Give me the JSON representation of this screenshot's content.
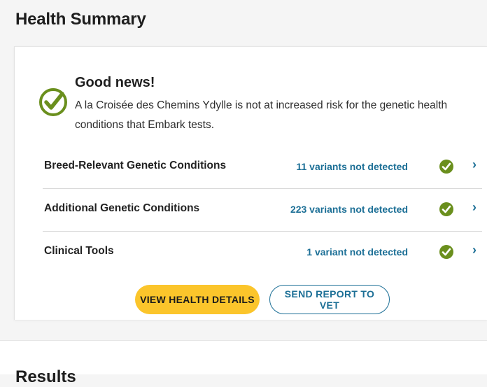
{
  "page": {
    "title": "Health Summary"
  },
  "summary": {
    "headline": "Good news!",
    "message": "A la Croisée des Chemins Ydylle is not at increased risk for the genetic health conditions that Embark tests.",
    "icon": "check-circle-icon"
  },
  "rows": [
    {
      "title": "Breed-Relevant Genetic Conditions",
      "status": "11 variants not detected"
    },
    {
      "title": "Additional Genetic Conditions",
      "status": "223 variants not detected"
    },
    {
      "title": "Clinical Tools",
      "status": "1 variant not detected"
    }
  ],
  "buttons": {
    "primary": "VIEW HEALTH DETAILS",
    "secondary": "SEND REPORT TO VET"
  },
  "next_section": {
    "title": "Results"
  },
  "colors": {
    "accent": "#1c6f96",
    "check": "#6a8f1d",
    "button_primary": "#fbc52b"
  }
}
